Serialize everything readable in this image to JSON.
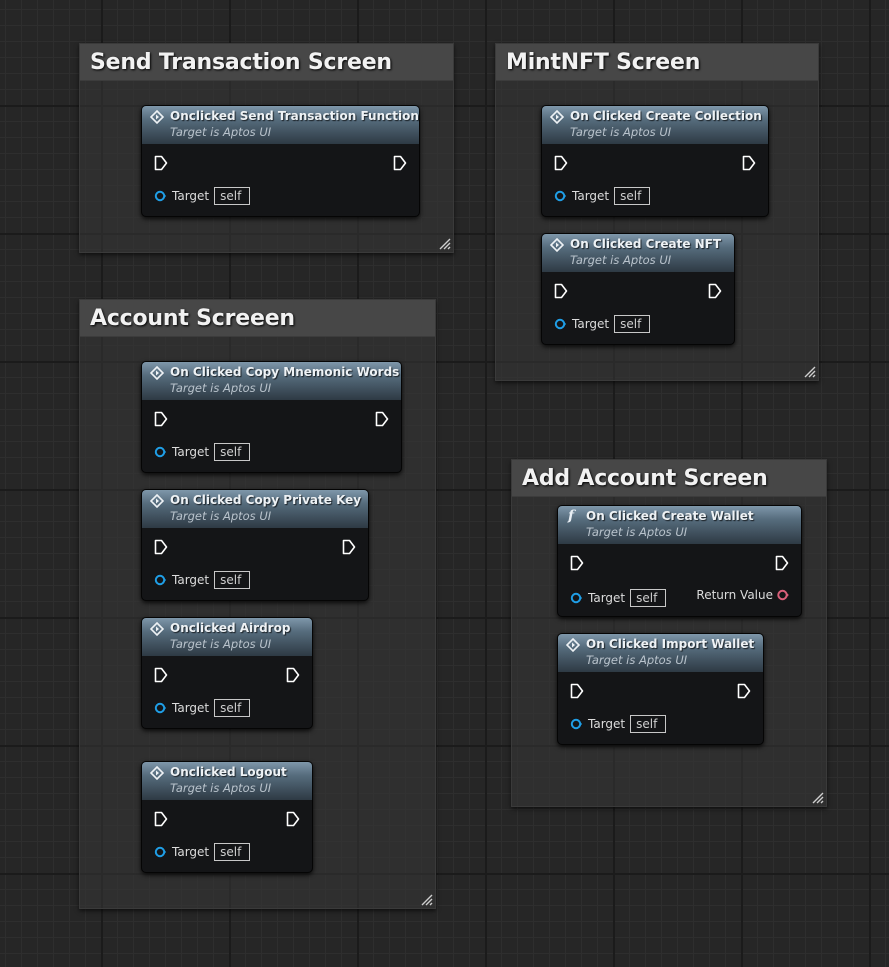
{
  "comments": [
    {
      "id": "send-transaction",
      "title": "Send Transaction Screen"
    },
    {
      "id": "mint-nft",
      "title": "MintNFT Screen"
    },
    {
      "id": "account",
      "title": "Account Screeen"
    },
    {
      "id": "add-account",
      "title": "Add Account Screen"
    }
  ],
  "nodes": [
    {
      "title": "Onclicked Send Transaction Function",
      "subtitle": "Target is Aptos UI",
      "pin_label": "Target",
      "pin_value": "self",
      "icon": "event-icon"
    },
    {
      "title": "On Clicked Create Collection",
      "subtitle": "Target is Aptos UI",
      "pin_label": "Target",
      "pin_value": "self",
      "icon": "event-icon"
    },
    {
      "title": "On Clicked Create NFT",
      "subtitle": "Target is Aptos UI",
      "pin_label": "Target",
      "pin_value": "self",
      "icon": "event-icon"
    },
    {
      "title": "On Clicked Copy Mnemonic Words",
      "subtitle": "Target is Aptos UI",
      "pin_label": "Target",
      "pin_value": "self",
      "icon": "event-icon"
    },
    {
      "title": "On Clicked Copy Private Key",
      "subtitle": "Target is Aptos UI",
      "pin_label": "Target",
      "pin_value": "self",
      "icon": "event-icon"
    },
    {
      "title": "Onclicked Airdrop",
      "subtitle": "Target is Aptos UI",
      "pin_label": "Target",
      "pin_value": "self",
      "icon": "event-icon"
    },
    {
      "title": "Onclicked Logout",
      "subtitle": "Target is Aptos UI",
      "pin_label": "Target",
      "pin_value": "self",
      "icon": "event-icon"
    },
    {
      "title": "On Clicked Create Wallet",
      "subtitle": "Target is Aptos UI",
      "pin_label": "Target",
      "pin_value": "self",
      "return_label": "Return Value",
      "icon": "function-icon",
      "icon_glyph": "f"
    },
    {
      "title": "On Clicked Import Wallet",
      "subtitle": "Target is Aptos UI",
      "pin_label": "Target",
      "pin_value": "self",
      "icon": "event-icon"
    }
  ],
  "colors": {
    "canvas": "#262626",
    "node_header_top": "#7e97aa",
    "node_body": "#141517",
    "object_pin": "#1f9ee6",
    "return_pin": "#d9607a",
    "exec_pin": "#ffffff"
  }
}
